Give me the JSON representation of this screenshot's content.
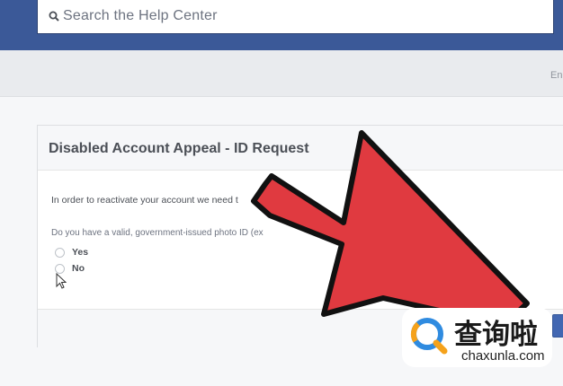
{
  "header": {
    "search_placeholder": "Search the Help Center"
  },
  "subbar": {
    "partial_text": "En"
  },
  "card": {
    "title": "Disabled Account Appeal - ID Request",
    "body_text": "In order to reactivate your account we need t",
    "question": "Do you have a valid, government-issued photo ID (ex",
    "options": [
      {
        "label": "Yes",
        "selected": false
      },
      {
        "label": "No",
        "selected": false
      }
    ]
  },
  "overlay": {
    "arrow_color": "#e03a40",
    "arrow_outline": "#111111"
  },
  "watermark": {
    "chinese_text": "查询啦",
    "domain_text": "chaxunla.com",
    "logo_colors": [
      "#f5a21b",
      "#2f8be0"
    ]
  },
  "colors": {
    "topbar": "#3b5998",
    "submit_button": "#4267b2"
  }
}
